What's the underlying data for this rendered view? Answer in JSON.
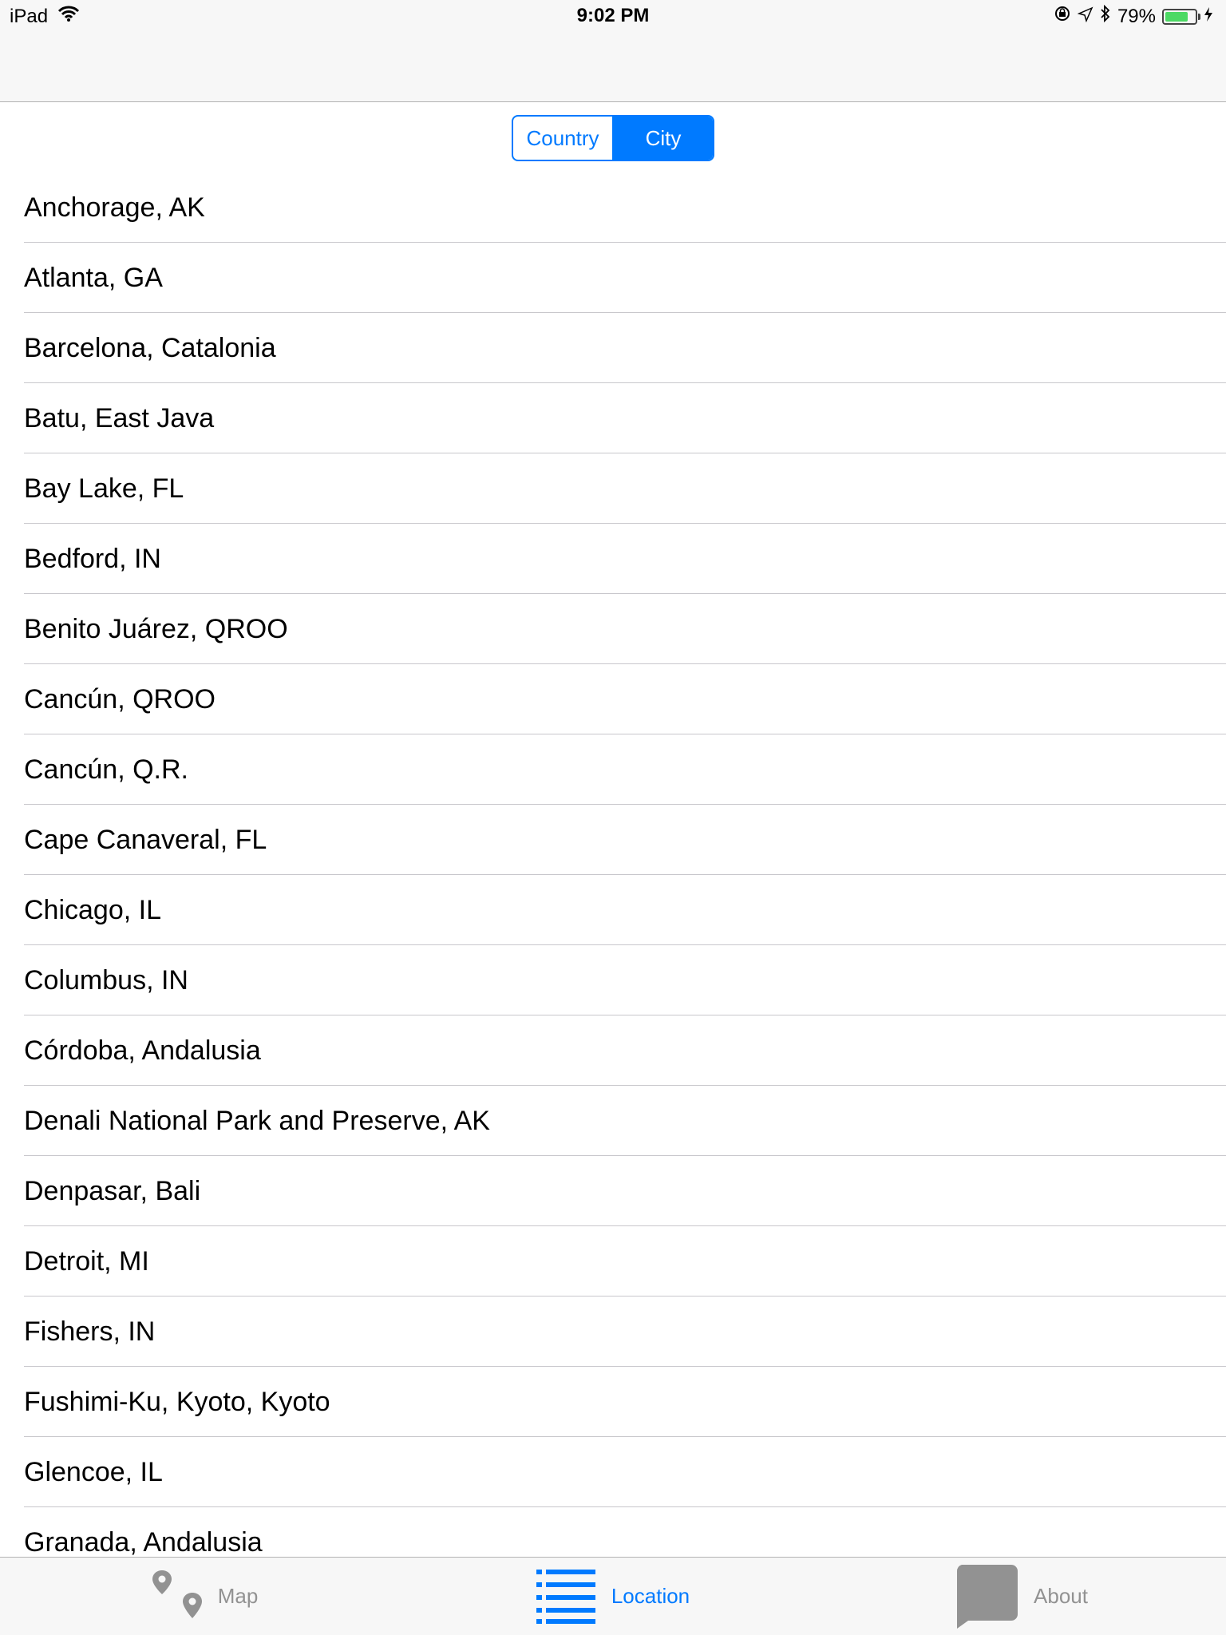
{
  "status_bar": {
    "carrier": "iPad",
    "time": "9:02 PM",
    "battery_percent": "79%",
    "battery_level": 0.79,
    "icons": [
      "wifi-icon",
      "rotation-lock-icon",
      "location-arrow-icon",
      "bluetooth-icon",
      "battery-icon",
      "charging-bolt-icon"
    ]
  },
  "segmented_control": {
    "segments": [
      "Country",
      "City"
    ],
    "selected": "City"
  },
  "cities": [
    "Anchorage, AK",
    "Atlanta, GA",
    "Barcelona, Catalonia",
    "Batu, East Java",
    "Bay Lake, FL",
    "Bedford, IN",
    "Benito Juárez, QROO",
    "Cancún, QROO",
    "Cancún, Q.R.",
    "Cape Canaveral, FL",
    "Chicago, IL",
    "Columbus, IN",
    "Córdoba, Andalusia",
    "Denali National Park and Preserve, AK",
    "Denpasar, Bali",
    "Detroit, MI",
    "Fishers, IN",
    "Fushimi-Ku, Kyoto, Kyoto",
    "Glencoe, IL",
    "Granada, Andalusia"
  ],
  "tab_bar": {
    "tabs": [
      {
        "label": "Map",
        "icon": "map-pins-icon"
      },
      {
        "label": "Location",
        "icon": "list-icon"
      },
      {
        "label": "About",
        "icon": "speech-bubble-icon"
      }
    ],
    "selected": "Location"
  },
  "colors": {
    "accent": "#007aff",
    "inactive": "#929292",
    "battery": "#4cd964"
  }
}
